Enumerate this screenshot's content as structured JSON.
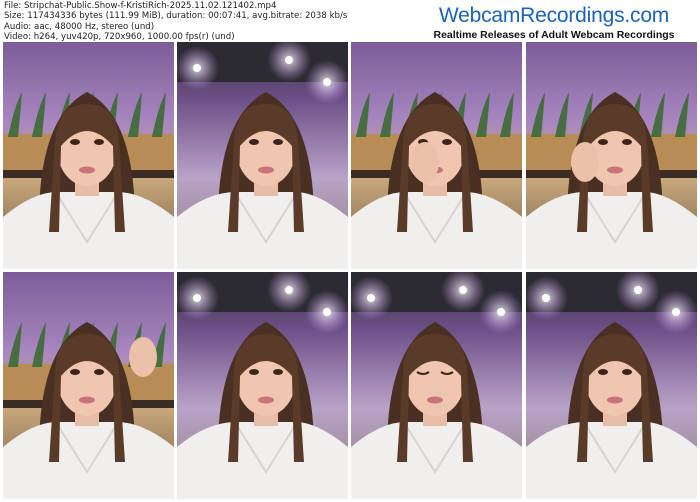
{
  "header": {
    "file_line": "File: Stripchat-Public.Show-f-KristiRich-2025.11.02.121402.mp4",
    "size_line": "Size: 117434336 bytes (111.99 MiB), duration: 00:07:41, avg.bitrate: 2038 kb/s",
    "audio_line": "Audio: aac, 48000 Hz, stereo (und)",
    "video_line": "Video: h264, yuv420p, 720x960, 1000.00 fps(r) (und)"
  },
  "brand": {
    "title": "WebcamRecordings.com",
    "subtitle": "Realtime Releases of Adult Webcam Recordings",
    "title_color": "#1d63b5"
  },
  "thumbnails": [
    {
      "scene": "purple-wall-plant",
      "shirt": "white-jacket"
    },
    {
      "scene": "ceiling-lights-closeup",
      "shirt": "white"
    },
    {
      "scene": "purple-wall-hand-at-face",
      "shirt": "white-jacket"
    },
    {
      "scene": "purple-wall-hand-at-cheek",
      "shirt": "white-jacket"
    },
    {
      "scene": "purple-wall-hand-raised",
      "shirt": "white-jacket"
    },
    {
      "scene": "ceiling-lights-closeup",
      "shirt": "white"
    },
    {
      "scene": "ceiling-lights-eyes-closed",
      "shirt": "white"
    },
    {
      "scene": "ceiling-lights-wide",
      "shirt": "white-jacket"
    }
  ]
}
